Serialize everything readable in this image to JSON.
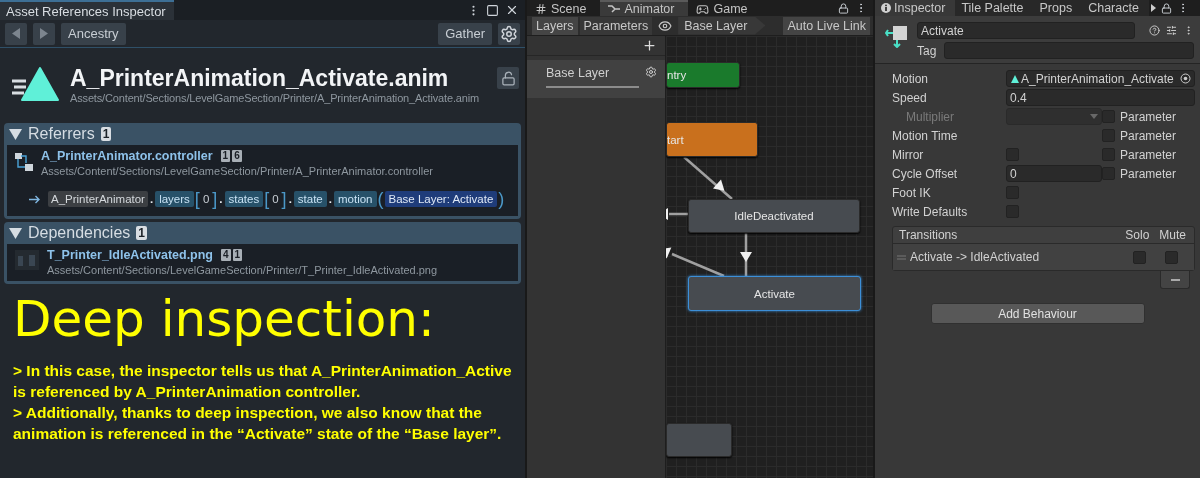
{
  "asset_inspector": {
    "tab": "Asset References Inspector",
    "toolbar": {
      "history_button": "Ancestry",
      "gather_button": "Gather"
    },
    "asset": {
      "name": "A_PrinterAnimation_Activate.anim",
      "path": "Assets/Content/Sections/LevelGameSection/Printer/A_PrinterAnimation_Activate.anim"
    },
    "sections": [
      {
        "title": "Referrers",
        "count": "1",
        "expanded": true,
        "items": [
          {
            "kind": "controller",
            "name": "A_PrinterAnimator.controller",
            "badges": [
              "1",
              "6"
            ],
            "path": "Assets/Content/Sections/LevelGameSection/Printer/A_PrinterAnimator.controller",
            "property_path": [
              {
                "kind": "object",
                "text": "A_PrinterAnimator"
              },
              {
                "kind": "dot",
                "text": "."
              },
              {
                "kind": "field",
                "text": "layers"
              },
              {
                "kind": "bracket",
                "text": "["
              },
              {
                "kind": "index",
                "text": "0"
              },
              {
                "kind": "bracket",
                "text": "]"
              },
              {
                "kind": "dot",
                "text": "."
              },
              {
                "kind": "field",
                "text": "states"
              },
              {
                "kind": "bracket",
                "text": "["
              },
              {
                "kind": "index",
                "text": "0"
              },
              {
                "kind": "bracket",
                "text": "]"
              },
              {
                "kind": "dot",
                "text": "."
              },
              {
                "kind": "field",
                "text": "state"
              },
              {
                "kind": "dot",
                "text": "."
              },
              {
                "kind": "field",
                "text": "motion"
              },
              {
                "kind": "bracket",
                "text": "("
              },
              {
                "kind": "value",
                "text": "Base Layer: Activate"
              },
              {
                "kind": "bracket",
                "text": ")"
              }
            ]
          }
        ]
      },
      {
        "title": "Dependencies",
        "count": "1",
        "expanded": true,
        "items": [
          {
            "kind": "texture",
            "name": "T_Printer_IdleActivated.png",
            "badges": [
              "4",
              "1"
            ],
            "path": "Assets/Content/Sections/LevelGameSection/Printer/T_Printer_IdleActivated.png"
          }
        ]
      }
    ]
  },
  "caption": {
    "title": "Deep inspection:",
    "paragraphs": [
      "> In this case, the inspector tells us that A_PrinterAnimation_Active is referenced by A_PrinterAnimation controller.",
      "> Additionally, thanks to deep inspection, we also know that the animation is referenced in the “Activate” state of the “Base layer”."
    ]
  },
  "animator": {
    "tabs": [
      {
        "label": "Scene",
        "selected": false
      },
      {
        "label": "Animator",
        "selected": true
      },
      {
        "label": "Game",
        "selected": false
      }
    ],
    "toolbar": {
      "tabs": [
        {
          "label": "Layers",
          "selected": true
        },
        {
          "label": "Parameters",
          "selected": false
        }
      ],
      "breadcrumb": "Base Layer",
      "live_link_button": "Auto Live Link"
    },
    "layers": [
      {
        "name": "Base Layer"
      }
    ],
    "nodes": [
      {
        "kind": "entry",
        "label": "ntry",
        "selected": false
      },
      {
        "kind": "default",
        "label": "tart",
        "selected": false
      },
      {
        "kind": "state",
        "label": "IdleDeactivated",
        "selected": false
      },
      {
        "kind": "state",
        "label": "Activate",
        "selected": true
      },
      {
        "kind": "state",
        "selected": false
      }
    ]
  },
  "inspector": {
    "tabs": [
      {
        "label": "Inspector",
        "selected": true
      },
      {
        "label": "Tile Palette",
        "selected": false
      },
      {
        "label": "Props",
        "selected": false
      },
      {
        "label": "Characte",
        "selected": false
      }
    ],
    "name": "Activate",
    "tag_label": "Tag",
    "properties": [
      {
        "kind": "object",
        "label": "Motion",
        "value": "A_PrinterAnimation_Activate",
        "disabled": false
      },
      {
        "kind": "text",
        "label": "Speed",
        "value": "0.4",
        "disabled": false
      },
      {
        "kind": "dropdown",
        "label": "Multiplier",
        "disabled": true,
        "parameter": {
          "label": "Parameter",
          "checked": false
        }
      },
      {
        "kind": "empty",
        "label": "Motion Time",
        "disabled": false,
        "parameter": {
          "label": "Parameter",
          "checked": false
        }
      },
      {
        "kind": "checkbox",
        "label": "Mirror",
        "checked": false,
        "disabled": false,
        "parameter": {
          "label": "Parameter",
          "checked": false
        }
      },
      {
        "kind": "text",
        "label": "Cycle Offset",
        "value": "0",
        "disabled": false,
        "parameter": {
          "label": "Parameter",
          "checked": false
        }
      },
      {
        "kind": "checkbox",
        "label": "Foot IK",
        "checked": false,
        "disabled": false
      },
      {
        "kind": "checkbox",
        "label": "Write Defaults",
        "checked": false,
        "disabled": false
      }
    ],
    "transitions": {
      "title": "Transitions",
      "columns": [
        "Solo",
        "Mute"
      ],
      "rows": [
        {
          "name": "Activate -> IdleActivated",
          "solo": false,
          "mute": false
        }
      ]
    },
    "add_button": "Add Behaviour"
  }
}
